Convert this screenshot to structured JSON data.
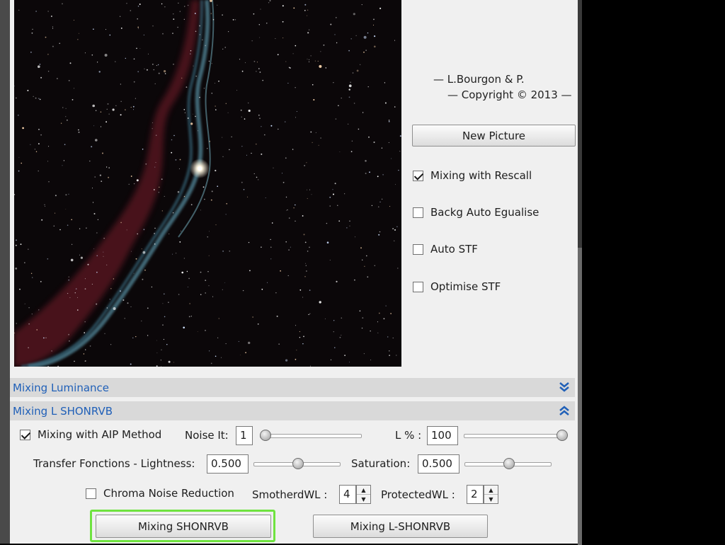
{
  "credits": {
    "line1": "— L.Bourgon & P.",
    "line2": "— Copyright © 2013 —"
  },
  "buttons": {
    "new_picture": "New Picture",
    "mixing_shonrvb": "Mixing SHONRVB",
    "mixing_l_shonrvb": "Mixing L-SHONRVB"
  },
  "options": {
    "mixing_rescall": {
      "label": "Mixing with Rescall",
      "checked": true
    },
    "backg_auto": {
      "label": "Backg Auto Egualise",
      "checked": false
    },
    "auto_stf": {
      "label": "Auto STF",
      "checked": false
    },
    "optimise_stf": {
      "label": "Optimise STF",
      "checked": false
    }
  },
  "sections": {
    "luminance": {
      "title": "Mixing Luminance",
      "state": "collapsed",
      "icon": "double-chevron-down-icon"
    },
    "l_shonrvb": {
      "title": "Mixing L SHONRVB",
      "state": "expanded",
      "icon": "double-chevron-up-icon"
    }
  },
  "controls": {
    "aip_method": {
      "label": "Mixing with AIP Method",
      "checked": true
    },
    "noise_it": {
      "label": "Noise It:",
      "value": "1",
      "slider_fraction": 0.0
    },
    "l_percent": {
      "label": "L % :",
      "value": "100",
      "slider_fraction": 1.0
    },
    "transfer_lightness": {
      "label": "Transfer Fonctions - Lightness:",
      "value": "0.500",
      "slider_fraction": 0.5
    },
    "saturation": {
      "label": "Saturation:",
      "value": "0.500",
      "slider_fraction": 0.5
    },
    "chroma_noise": {
      "label": "Chroma Noise Reduction",
      "checked": false
    },
    "smothered_wl": {
      "label": "SmotherdWL :",
      "value": "4"
    },
    "protected_wl": {
      "label": "ProtectedWL :",
      "value": "2"
    }
  },
  "colors": {
    "section_title": "#2060b8",
    "highlight": "#6fe340"
  }
}
